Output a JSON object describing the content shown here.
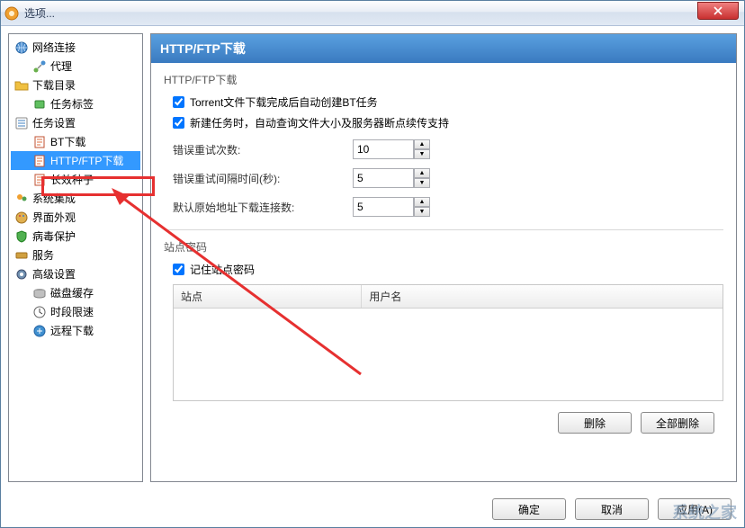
{
  "window": {
    "title": "选项..."
  },
  "tree": {
    "items": [
      {
        "label": "网络连接",
        "lvl": 0,
        "icon": "globe"
      },
      {
        "label": "代理",
        "lvl": 1,
        "icon": "network"
      },
      {
        "label": "下载目录",
        "lvl": 0,
        "icon": "folder"
      },
      {
        "label": "任务标签",
        "lvl": 1,
        "icon": "tag"
      },
      {
        "label": "任务设置",
        "lvl": 0,
        "icon": "tasks"
      },
      {
        "label": "BT下载",
        "lvl": 1,
        "icon": "page"
      },
      {
        "label": "HTTP/FTP下载",
        "lvl": 1,
        "icon": "page",
        "selected": true
      },
      {
        "label": "长效种子",
        "lvl": 1,
        "icon": "page"
      },
      {
        "label": "系统集成",
        "lvl": 0,
        "icon": "users"
      },
      {
        "label": "界面外观",
        "lvl": 0,
        "icon": "palette"
      },
      {
        "label": "病毒保护",
        "lvl": 0,
        "icon": "shield"
      },
      {
        "label": "服务",
        "lvl": 0,
        "icon": "service"
      },
      {
        "label": "高级设置",
        "lvl": 0,
        "icon": "gear"
      },
      {
        "label": "磁盘缓存",
        "lvl": 1,
        "icon": "disk"
      },
      {
        "label": "时段限速",
        "lvl": 1,
        "icon": "clock"
      },
      {
        "label": "远程下载",
        "lvl": 1,
        "icon": "remote"
      }
    ]
  },
  "panel": {
    "title": "HTTP/FTP下载",
    "group1": "HTTP/FTP下载",
    "cb_auto_bt": "Torrent文件下载完成后自动创建BT任务",
    "cb_auto_bt_checked": true,
    "cb_query": "新建任务时，自动查询文件大小及服务器断点续传支持",
    "cb_query_checked": true,
    "f_retry_count": "错误重试次数:",
    "f_retry_count_val": "10",
    "f_retry_interval": "错误重试间隔时间(秒):",
    "f_retry_interval_val": "5",
    "f_conn": "默认原始地址下载连接数:",
    "f_conn_val": "5",
    "group2": "站点密码",
    "cb_remember": "记住站点密码",
    "cb_remember_checked": true,
    "th_site": "站点",
    "th_user": "用户名",
    "btn_delete": "删除",
    "btn_delete_all": "全部删除"
  },
  "footer": {
    "ok": "确定",
    "cancel": "取消",
    "apply": "应用(A)"
  },
  "watermark": "系统之家"
}
